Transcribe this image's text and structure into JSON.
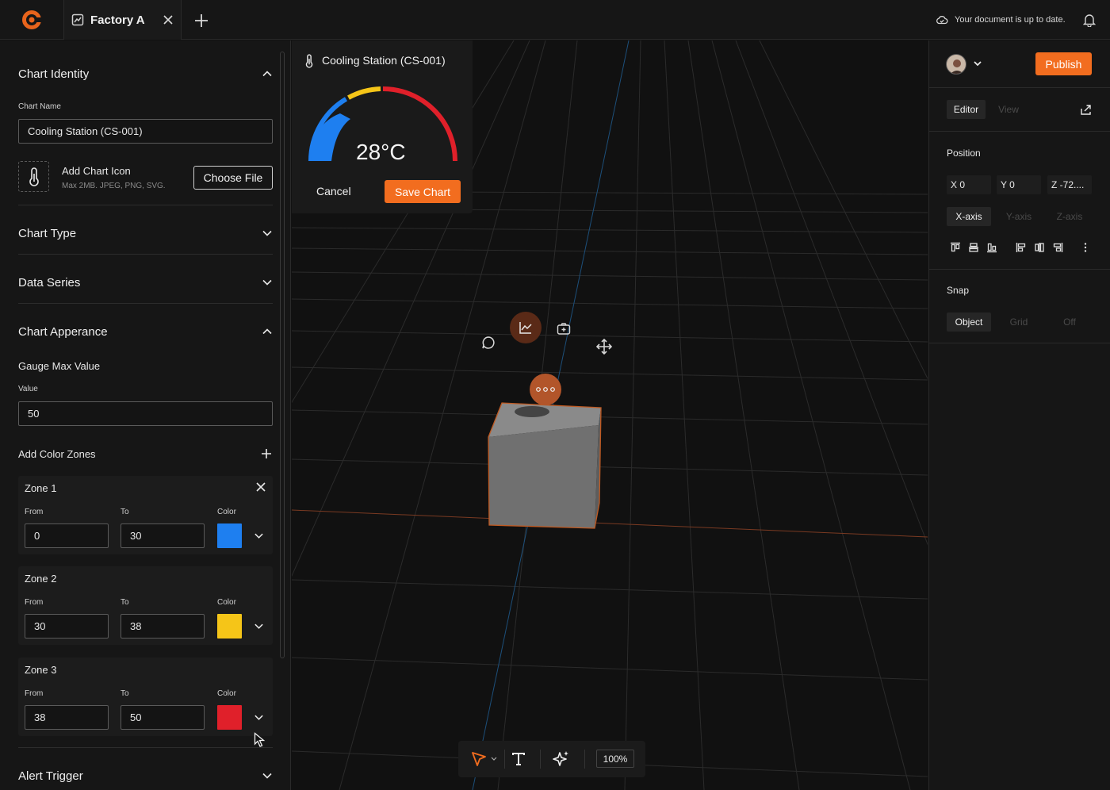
{
  "topbar": {
    "tab_title": "Factory A",
    "doc_status": "Your document is up to date."
  },
  "left_panel": {
    "chart_identity": {
      "title": "Chart Identity",
      "chart_name_label": "Chart Name",
      "chart_name_value": "Cooling Station (CS-001)",
      "add_icon_label": "Add Chart Icon",
      "add_icon_hint": "Max 2MB. JPEG, PNG, SVG.",
      "choose_file": "Choose File"
    },
    "chart_type": {
      "title": "Chart Type"
    },
    "data_series": {
      "title": "Data Series"
    },
    "chart_appearance": {
      "title": "Chart Apperance",
      "gauge_max_label": "Gauge Max Value",
      "value_label": "Value",
      "value": "50",
      "color_zones_label": "Add Color Zones",
      "from_label": "From",
      "to_label": "To",
      "color_label": "Color",
      "zones": [
        {
          "name": "Zone 1",
          "from": "0",
          "to": "30",
          "color": "#1e7ff0"
        },
        {
          "name": "Zone 2",
          "from": "30",
          "to": "38",
          "color": "#f5c518"
        },
        {
          "name": "Zone 3",
          "from": "38",
          "to": "50",
          "color": "#e0202a"
        }
      ]
    },
    "alert_trigger": {
      "title": "Alert Trigger"
    }
  },
  "viewport": {
    "chart_card": {
      "title": "Cooling Station (CS-001)",
      "value": "28°C",
      "gauge_current": 28,
      "gauge_max": 50,
      "cancel": "Cancel",
      "save": "Save Chart"
    },
    "object_tools": [
      "chat-icon",
      "chart-icon",
      "camera-icon",
      "move-icon",
      "more-icon"
    ],
    "toolbar": {
      "zoom": "100%"
    }
  },
  "right_panel": {
    "publish": "Publish",
    "mode_tabs": [
      "Editor",
      "View"
    ],
    "position_label": "Position",
    "coords": [
      "X 0",
      "Y 0",
      "Z -72...."
    ],
    "axes": [
      "X-axis",
      "Y-axis",
      "Z-axis"
    ],
    "snap_label": "Snap",
    "snap_options": [
      "Object",
      "Grid",
      "Off"
    ]
  },
  "colors": {
    "accent": "#f26d1f",
    "background": "#111111",
    "panel": "#161616"
  }
}
